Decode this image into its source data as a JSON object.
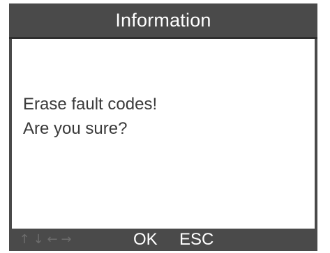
{
  "dialog": {
    "title": "Information",
    "message_line1": "Erase fault codes!",
    "message_line2": "Are you sure?"
  },
  "bottom_bar": {
    "icons": {
      "up": "↑",
      "down": "↓",
      "left": "←",
      "right": "→"
    },
    "ok_label": "OK",
    "esc_label": "ESC"
  },
  "colors": {
    "bar_background": "#4a4a4a",
    "screen_background": "#ffffff",
    "title_text": "#ffffff",
    "message_text": "#3a3a3a",
    "inactive_arrows": "#6c6c6c"
  }
}
